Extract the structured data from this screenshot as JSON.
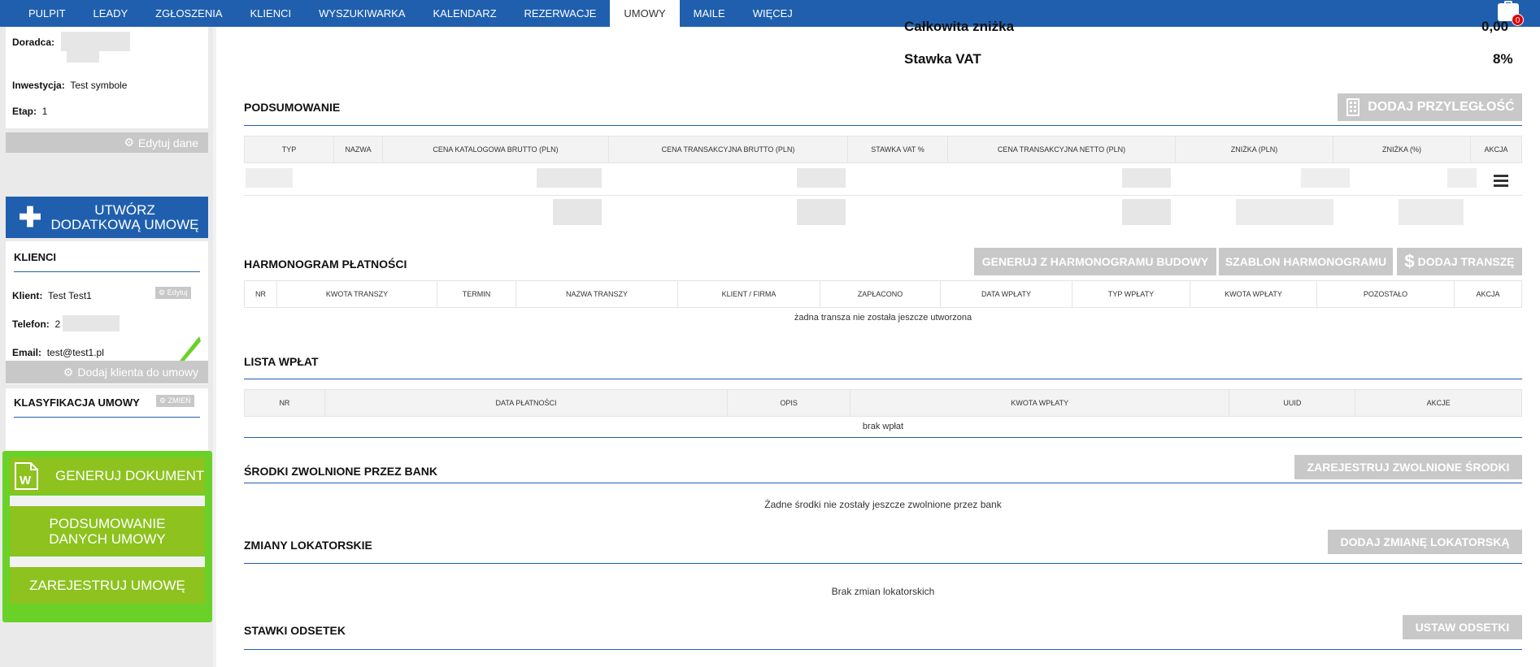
{
  "nav": {
    "items": [
      "PULPIT",
      "LEADY",
      "ZGŁOSZENIA",
      "KLIENCI",
      "WYSZUKIWARKA",
      "KALENDARZ",
      "REZERWACJE",
      "UMOWY",
      "MAILE",
      "WIĘCEJ"
    ],
    "active": "UMOWY",
    "cart_count": "0"
  },
  "sidebar": {
    "doradca_label": "Doradca:",
    "inwestycja_label": "Inwestycja:",
    "inwestycja_value": "Test symbole",
    "etap_label": "Etap:",
    "etap_value": "1",
    "edit_data_label": "Edytuj dane",
    "create_extra_label": "UTWÓRZ DODATKOWĄ UMOWĘ",
    "clients_title": "KLIENCI",
    "client_label": "Klient:",
    "client_value": "Test Test1",
    "client_edit_label": "Edytuj",
    "phone_label": "Telefon:",
    "phone_value": "2",
    "email_label": "Email:",
    "email_value": "test@test1.pl",
    "add_client_label": "Dodaj klienta do umowy",
    "classification_title": "KLASYFIKACJA UMOWY",
    "change_label": "ZMIEŃ",
    "generate_doc_label": "GENERUJ DOKUMENT",
    "summary_data_label": "PODSUMOWANIE DANYCH UMOWY",
    "register_contract_label": "ZAREJESTRUJ UMOWĘ"
  },
  "top_summary": {
    "total_discount_label": "Całkowita zniżka",
    "total_discount_value": "0,00",
    "vat_label": "Stawka VAT",
    "vat_value": "8%"
  },
  "podsumowanie": {
    "title": "PODSUMOWANIE",
    "add_button": "DODAJ PRZYLEGŁOŚĆ",
    "columns": [
      "TYP",
      "NAZWA",
      "CENA KATALOGOWA BRUTTO (PLN)",
      "CENA TRANSAKCYJNA BRUTTO (PLN)",
      "STAWKA VAT %",
      "CENA TRANSAKCYJNA NETTO (PLN)",
      "ZNIŻKA (PLN)",
      "ZNIŻKA (%)",
      "AKCJA"
    ]
  },
  "harmonogram": {
    "title": "HARMONOGRAM PŁATNOŚCI",
    "btn_generate": "GENERUJ Z HARMONOGRAMU BUDOWY",
    "btn_template": "SZABLON HARMONOGRAMU",
    "btn_add": "DODAJ TRANSZĘ",
    "columns": [
      "NR",
      "KWOTA TRANSZY",
      "TERMIN",
      "NAZWA TRANSZY",
      "KLIENT / FIRMA",
      "ZAPŁACONO",
      "DATA WPŁATY",
      "TYP WPŁATY",
      "KWOTA WPŁATY",
      "POZOSTAŁO",
      "AKCJA"
    ],
    "empty": "żadna transza nie została jeszcze utworzona"
  },
  "wplaty": {
    "title": "LISTA WPŁAT",
    "columns": [
      "NR",
      "DATA PŁATNOŚCI",
      "OPIS",
      "KWOTA WPŁATY",
      "UUID",
      "AKCJE"
    ],
    "empty": "brak wpłat"
  },
  "srodki": {
    "title": "ŚRODKI ZWOLNIONE PRZEZ BANK",
    "btn": "ZAREJESTRUJ ZWOLNIONE ŚRODKI",
    "empty": "Żadne środki nie zostały jeszcze zwolnione przez bank"
  },
  "zmiany": {
    "title": "ZMIANY LOKATORSKIE",
    "btn": "DODAJ ZMIANĘ LOKATORSKĄ",
    "empty": "Brak zmian lokatorskich"
  },
  "odsetki": {
    "title": "STAWKI ODSETEK",
    "btn": "USTAW ODSETKI"
  },
  "colors": {
    "nav_blue": "#1f5fae",
    "green_frame": "#6ad128",
    "green_button": "#8dc21f",
    "grey_button": "#c8c8c8"
  }
}
